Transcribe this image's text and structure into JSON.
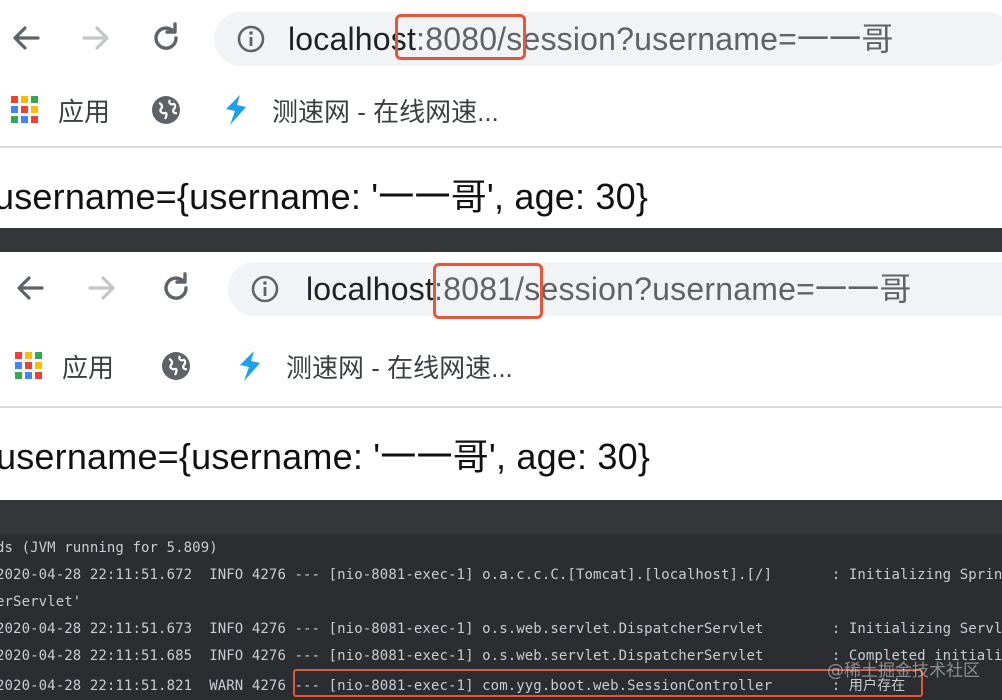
{
  "browser_top": {
    "url_host": "localhost",
    "url_port": ":8080/",
    "url_rest": "session?username=一一哥",
    "bookmarks": [
      {
        "label": "应用",
        "icon": "apps-grid-icon"
      },
      {
        "label": "",
        "icon": "globe-icon"
      },
      {
        "label": "测速网 - 在线网速...",
        "icon": "speedtest-icon"
      }
    ],
    "page_text": "username={username: '一一哥', age: 30}"
  },
  "browser_bottom": {
    "url_host": "localhost",
    "url_port": ":8081/",
    "url_rest": "session?username=一一哥",
    "bookmarks": [
      {
        "label": "应用",
        "icon": "apps-grid-icon"
      },
      {
        "label": "",
        "icon": "globe-icon"
      },
      {
        "label": "测速网 - 在线网速...",
        "icon": "speedtest-icon"
      }
    ],
    "page_text": "username={username: '一一哥', age: 30}"
  },
  "console": {
    "lines": [
      "ds (JVM running for 5.809)",
      "2020-04-28 22:11:51.672  INFO 4276 --- [nio-8081-exec-1] o.a.c.c.C.[Tomcat].[localhost].[/]       : Initializing Spring DispatcherServlet",
      "erServlet'",
      "2020-04-28 22:11:51.673  INFO 4276 --- [nio-8081-exec-1] o.s.web.servlet.DispatcherServlet        : Initializing Servlet 'dispatcherServlet'",
      "2020-04-28 22:11:51.685  INFO 4276 --- [nio-8081-exec-1] o.s.web.servlet.DispatcherServlet        : Completed initialization in",
      "2020-04-28 22:11:51.821  WARN 4276 --- [nio-8081-exec-1] com.yyg.boot.web.SessionController       : 用户存在"
    ],
    "watermark": "@稀土掘金技术社区"
  },
  "colors": {
    "highlight": "#e5573a",
    "console_bg": "#2b2d30"
  }
}
